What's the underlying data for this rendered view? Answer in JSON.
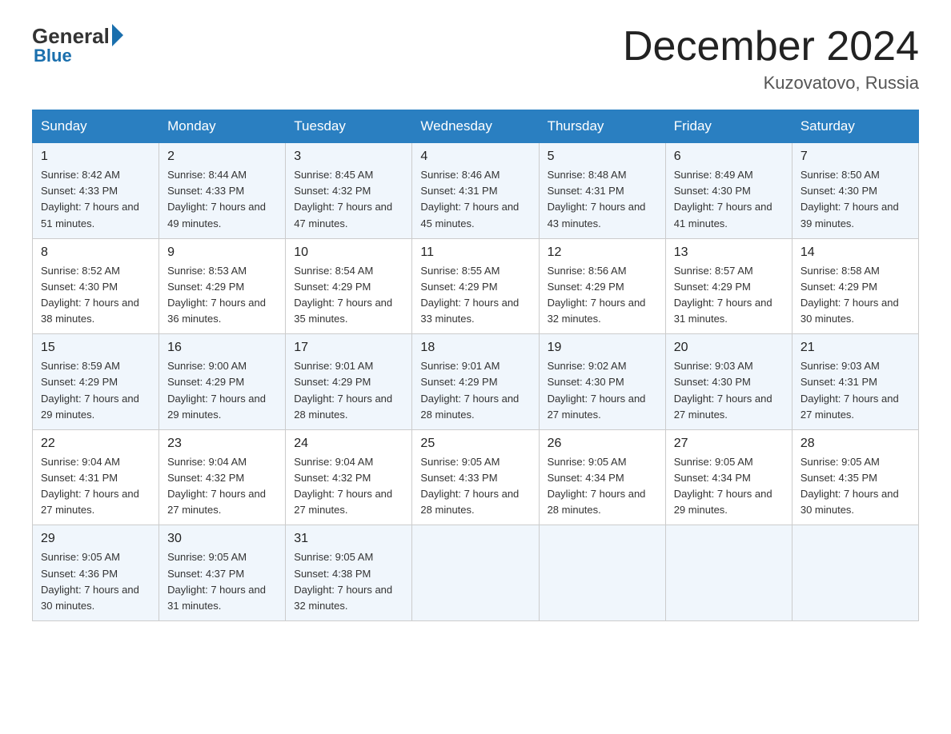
{
  "header": {
    "logo": {
      "general": "General",
      "blue": "Blue"
    },
    "title": "December 2024",
    "location": "Kuzovatovo, Russia"
  },
  "columns": [
    "Sunday",
    "Monday",
    "Tuesday",
    "Wednesday",
    "Thursday",
    "Friday",
    "Saturday"
  ],
  "weeks": [
    [
      {
        "day": "1",
        "sunrise": "8:42 AM",
        "sunset": "4:33 PM",
        "daylight": "7 hours and 51 minutes."
      },
      {
        "day": "2",
        "sunrise": "8:44 AM",
        "sunset": "4:33 PM",
        "daylight": "7 hours and 49 minutes."
      },
      {
        "day": "3",
        "sunrise": "8:45 AM",
        "sunset": "4:32 PM",
        "daylight": "7 hours and 47 minutes."
      },
      {
        "day": "4",
        "sunrise": "8:46 AM",
        "sunset": "4:31 PM",
        "daylight": "7 hours and 45 minutes."
      },
      {
        "day": "5",
        "sunrise": "8:48 AM",
        "sunset": "4:31 PM",
        "daylight": "7 hours and 43 minutes."
      },
      {
        "day": "6",
        "sunrise": "8:49 AM",
        "sunset": "4:30 PM",
        "daylight": "7 hours and 41 minutes."
      },
      {
        "day": "7",
        "sunrise": "8:50 AM",
        "sunset": "4:30 PM",
        "daylight": "7 hours and 39 minutes."
      }
    ],
    [
      {
        "day": "8",
        "sunrise": "8:52 AM",
        "sunset": "4:30 PM",
        "daylight": "7 hours and 38 minutes."
      },
      {
        "day": "9",
        "sunrise": "8:53 AM",
        "sunset": "4:29 PM",
        "daylight": "7 hours and 36 minutes."
      },
      {
        "day": "10",
        "sunrise": "8:54 AM",
        "sunset": "4:29 PM",
        "daylight": "7 hours and 35 minutes."
      },
      {
        "day": "11",
        "sunrise": "8:55 AM",
        "sunset": "4:29 PM",
        "daylight": "7 hours and 33 minutes."
      },
      {
        "day": "12",
        "sunrise": "8:56 AM",
        "sunset": "4:29 PM",
        "daylight": "7 hours and 32 minutes."
      },
      {
        "day": "13",
        "sunrise": "8:57 AM",
        "sunset": "4:29 PM",
        "daylight": "7 hours and 31 minutes."
      },
      {
        "day": "14",
        "sunrise": "8:58 AM",
        "sunset": "4:29 PM",
        "daylight": "7 hours and 30 minutes."
      }
    ],
    [
      {
        "day": "15",
        "sunrise": "8:59 AM",
        "sunset": "4:29 PM",
        "daylight": "7 hours and 29 minutes."
      },
      {
        "day": "16",
        "sunrise": "9:00 AM",
        "sunset": "4:29 PM",
        "daylight": "7 hours and 29 minutes."
      },
      {
        "day": "17",
        "sunrise": "9:01 AM",
        "sunset": "4:29 PM",
        "daylight": "7 hours and 28 minutes."
      },
      {
        "day": "18",
        "sunrise": "9:01 AM",
        "sunset": "4:29 PM",
        "daylight": "7 hours and 28 minutes."
      },
      {
        "day": "19",
        "sunrise": "9:02 AM",
        "sunset": "4:30 PM",
        "daylight": "7 hours and 27 minutes."
      },
      {
        "day": "20",
        "sunrise": "9:03 AM",
        "sunset": "4:30 PM",
        "daylight": "7 hours and 27 minutes."
      },
      {
        "day": "21",
        "sunrise": "9:03 AM",
        "sunset": "4:31 PM",
        "daylight": "7 hours and 27 minutes."
      }
    ],
    [
      {
        "day": "22",
        "sunrise": "9:04 AM",
        "sunset": "4:31 PM",
        "daylight": "7 hours and 27 minutes."
      },
      {
        "day": "23",
        "sunrise": "9:04 AM",
        "sunset": "4:32 PM",
        "daylight": "7 hours and 27 minutes."
      },
      {
        "day": "24",
        "sunrise": "9:04 AM",
        "sunset": "4:32 PM",
        "daylight": "7 hours and 27 minutes."
      },
      {
        "day": "25",
        "sunrise": "9:05 AM",
        "sunset": "4:33 PM",
        "daylight": "7 hours and 28 minutes."
      },
      {
        "day": "26",
        "sunrise": "9:05 AM",
        "sunset": "4:34 PM",
        "daylight": "7 hours and 28 minutes."
      },
      {
        "day": "27",
        "sunrise": "9:05 AM",
        "sunset": "4:34 PM",
        "daylight": "7 hours and 29 minutes."
      },
      {
        "day": "28",
        "sunrise": "9:05 AM",
        "sunset": "4:35 PM",
        "daylight": "7 hours and 30 minutes."
      }
    ],
    [
      {
        "day": "29",
        "sunrise": "9:05 AM",
        "sunset": "4:36 PM",
        "daylight": "7 hours and 30 minutes."
      },
      {
        "day": "30",
        "sunrise": "9:05 AM",
        "sunset": "4:37 PM",
        "daylight": "7 hours and 31 minutes."
      },
      {
        "day": "31",
        "sunrise": "9:05 AM",
        "sunset": "4:38 PM",
        "daylight": "7 hours and 32 minutes."
      },
      null,
      null,
      null,
      null
    ]
  ]
}
